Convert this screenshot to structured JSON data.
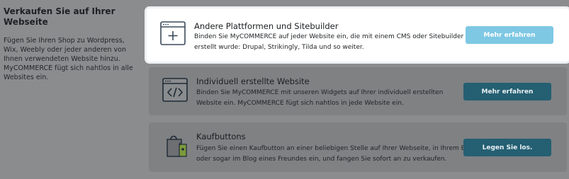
{
  "sidebar": {
    "title": "Verkaufen Sie auf Ihrer Webseite",
    "description": "Fügen Sie Ihren Shop zu Wordpress, Wix, Weebly oder jeder anderen von Ihnen verwendeten Website hinzu. MyCOMMERCE fügt sich nahtlos in alle Websites ein."
  },
  "cards": [
    {
      "title": "Andere Plattformen und Sitebuilder",
      "description": "Binden Sie MyCOMMERCE auf jeder Website ein, die mit einem CMS oder Sitebuilder erstellt wurde: Drupal, Strikingly, Tilda und so weiter.",
      "button_label": "Mehr erfahren",
      "icon": "browser-plus-icon",
      "selected": true
    },
    {
      "title": "Individuell erstellte Website",
      "description": "Binden Sie MyCOMMERCE mit unseren Widgets auf Ihrer individuell erstellten Website ein. MyCOMMERCE fügt sich nahtlos in jede Website ein.",
      "button_label": "Mehr erfahren",
      "icon": "browser-code-icon",
      "selected": false
    },
    {
      "title": "Kaufbuttons",
      "description": "Fügen Sie einen Kaufbutton an einer beliebigen Stelle auf Ihrer Webseite, in Ihrem Blog oder sogar im Blog eines Freundes ein, und fangen Sie sofort an zu verkaufen.",
      "button_label": "Legen Sie los.",
      "icon": "shopping-bag-icon",
      "selected": false
    }
  ],
  "colors": {
    "overlay": "#8b8c8e",
    "active_card": "#ffffff",
    "active_button": "#7ec8e4",
    "button": "#255f72"
  }
}
